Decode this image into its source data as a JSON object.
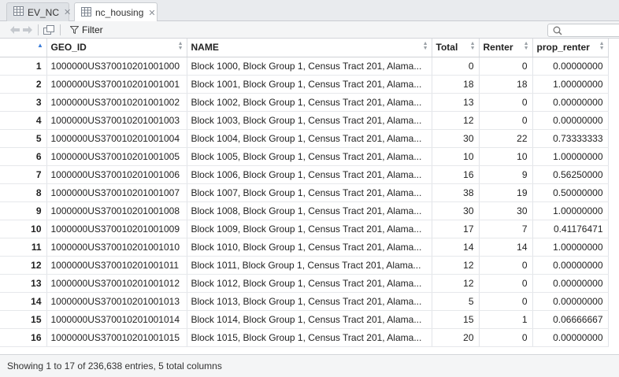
{
  "tabs": [
    {
      "label": "EV_NC",
      "active": false
    },
    {
      "label": "nc_housing",
      "active": true
    }
  ],
  "toolbar": {
    "filter_label": "Filter",
    "search_placeholder": ""
  },
  "table": {
    "columns": [
      "",
      "GEO_ID",
      "NAME",
      "Total",
      "Renter",
      "prop_renter"
    ],
    "rows": [
      [
        "1",
        "1000000US370010201001000",
        "Block 1000, Block Group 1, Census Tract 201, Alama...",
        "0",
        "0",
        "0.00000000"
      ],
      [
        "2",
        "1000000US370010201001001",
        "Block 1001, Block Group 1, Census Tract 201, Alama...",
        "18",
        "18",
        "1.00000000"
      ],
      [
        "3",
        "1000000US370010201001002",
        "Block 1002, Block Group 1, Census Tract 201, Alama...",
        "13",
        "0",
        "0.00000000"
      ],
      [
        "4",
        "1000000US370010201001003",
        "Block 1003, Block Group 1, Census Tract 201, Alama...",
        "12",
        "0",
        "0.00000000"
      ],
      [
        "5",
        "1000000US370010201001004",
        "Block 1004, Block Group 1, Census Tract 201, Alama...",
        "30",
        "22",
        "0.73333333"
      ],
      [
        "6",
        "1000000US370010201001005",
        "Block 1005, Block Group 1, Census Tract 201, Alama...",
        "10",
        "10",
        "1.00000000"
      ],
      [
        "7",
        "1000000US370010201001006",
        "Block 1006, Block Group 1, Census Tract 201, Alama...",
        "16",
        "9",
        "0.56250000"
      ],
      [
        "8",
        "1000000US370010201001007",
        "Block 1007, Block Group 1, Census Tract 201, Alama...",
        "38",
        "19",
        "0.50000000"
      ],
      [
        "9",
        "1000000US370010201001008",
        "Block 1008, Block Group 1, Census Tract 201, Alama...",
        "30",
        "30",
        "1.00000000"
      ],
      [
        "10",
        "1000000US370010201001009",
        "Block 1009, Block Group 1, Census Tract 201, Alama...",
        "17",
        "7",
        "0.41176471"
      ],
      [
        "11",
        "1000000US370010201001010",
        "Block 1010, Block Group 1, Census Tract 201, Alama...",
        "14",
        "14",
        "1.00000000"
      ],
      [
        "12",
        "1000000US370010201001011",
        "Block 1011, Block Group 1, Census Tract 201, Alama...",
        "12",
        "0",
        "0.00000000"
      ],
      [
        "13",
        "1000000US370010201001012",
        "Block 1012, Block Group 1, Census Tract 201, Alama...",
        "12",
        "0",
        "0.00000000"
      ],
      [
        "14",
        "1000000US370010201001013",
        "Block 1013, Block Group 1, Census Tract 201, Alama...",
        "5",
        "0",
        "0.00000000"
      ],
      [
        "15",
        "1000000US370010201001014",
        "Block 1014, Block Group 1, Census Tract 201, Alama...",
        "15",
        "1",
        "0.06666667"
      ],
      [
        "16",
        "1000000US370010201001015",
        "Block 1015, Block Group 1, Census Tract 201, Alama...",
        "20",
        "0",
        "0.00000000"
      ]
    ]
  },
  "status": {
    "text": "Showing 1 to 17 of 236,638 entries, 5 total columns"
  },
  "icons": {
    "tab_icon": "table-icon",
    "back": "back-arrow-icon",
    "forward": "forward-arrow-icon",
    "popout": "popout-icon",
    "filter": "filter-icon",
    "search": "search-icon"
  },
  "colors": {
    "sort_accent": "#3c7dd9"
  }
}
